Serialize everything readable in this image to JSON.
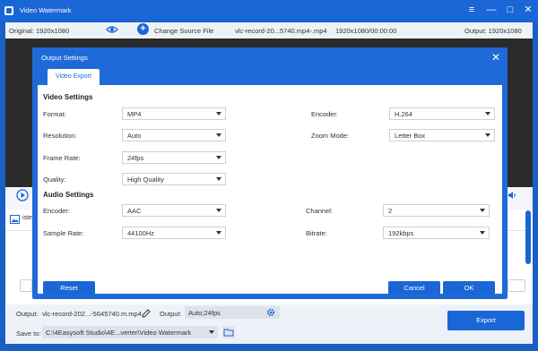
{
  "window": {
    "title": "Video Watermark"
  },
  "toolbar": {
    "original_label": "Original: 1920x1080",
    "change_source_label": "Change Source File",
    "file_name": "vlc-record-20...5740.mp4-.mp4",
    "resolution_time": "1920x1080/00:00:00",
    "output_label": "Output: 1920x1080"
  },
  "side_tab": {
    "label": "iste"
  },
  "bottom": {
    "output_label": "Output:",
    "output_file": "vlc-record-202...-5645740.m.mp4",
    "output2_label": "Output:",
    "output2_value": "Auto;24fps",
    "save_label": "Save to:",
    "save_path": "C:\\4Easysoft Studio\\4E...verter\\Video Watermark",
    "export_label": "Export"
  },
  "dialog": {
    "title": "Output Settings",
    "tab_label": "Video Export",
    "video_section": "Video Settings",
    "audio_section": "Audio Settings",
    "video": {
      "format_label": "Format:",
      "format_value": "MP4",
      "encoder_label": "Encoder:",
      "encoder_value": "H.264",
      "resolution_label": "Resolution:",
      "resolution_value": "Auto",
      "zoom_label": "Zoom Mode:",
      "zoom_value": "Letter Box",
      "framerate_label": "Frame Rate:",
      "framerate_value": "24fps",
      "quality_label": "Quality:",
      "quality_value": "High Quality"
    },
    "audio": {
      "encoder_label": "Encoder:",
      "encoder_value": "AAC",
      "channel_label": "Channel:",
      "channel_value": "2",
      "samplerate_label": "Sample Rate:",
      "samplerate_value": "44100Hz",
      "bitrate_label": "Bitrate:",
      "bitrate_value": "192kbps"
    },
    "reset_label": "Reset",
    "cancel_label": "Cancel",
    "ok_label": "OK"
  },
  "colors": {
    "accent": "#1a66d6",
    "dialog_frame": "#1f6ad8"
  }
}
